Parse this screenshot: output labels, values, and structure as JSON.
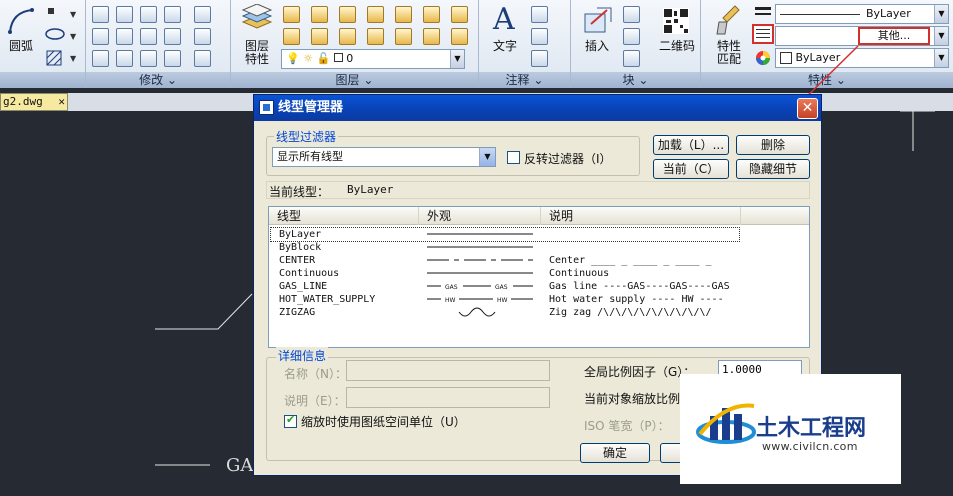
{
  "ribbon": {
    "draw": {
      "arc_label": "圆弧"
    },
    "modify": {
      "title": "修改 ⌄"
    },
    "layers": {
      "props_label_1": "图层",
      "props_label_2": "特性",
      "title": "图层",
      "layer_value": "0"
    },
    "annotation": {
      "text_label": "文字",
      "title": "注释"
    },
    "block": {
      "insert_label": "插入",
      "title": "块"
    },
    "qrcode": {
      "label": "二维码"
    },
    "properties": {
      "match_label_1": "特性",
      "match_label_2": "匹配",
      "lineweight_value": "ByLayer",
      "linetype_value": "其他...",
      "color_value": "ByLayer",
      "title": "特性"
    }
  },
  "doc_tab": {
    "label": "g2.dwg",
    "close": "✕"
  },
  "drawing": {
    "gas_label": "GAS"
  },
  "dialog": {
    "title": "线型管理器",
    "close": "✕",
    "filter_group": "线型过滤器",
    "filter_value": "显示所有线型",
    "invert_filter": "反转过滤器（I）",
    "buttons": {
      "load": "加载（L）...",
      "delete": "删除",
      "current": "当前（C）",
      "hide_details": "隐藏细节（D）"
    },
    "current_linetype_label": "当前线型：",
    "current_linetype_value": "ByLayer",
    "columns": [
      "线型",
      "外观",
      "说明"
    ],
    "rows": [
      {
        "name": "ByLayer",
        "desc": ""
      },
      {
        "name": "ByBlock",
        "desc": ""
      },
      {
        "name": "CENTER",
        "desc": "Center ____ _ ____ _ ____ _"
      },
      {
        "name": "Continuous",
        "desc": "Continuous"
      },
      {
        "name": "GAS_LINE",
        "desc": "Gas line ----GAS----GAS----GAS"
      },
      {
        "name": "HOT_WATER_SUPPLY",
        "desc": "Hot water supply ---- HW ----"
      },
      {
        "name": "ZIGZAG",
        "desc": "Zig zag /\\/\\/\\/\\/\\/\\/\\/\\/\\/"
      }
    ],
    "details_group": "详细信息",
    "name_label": "名称（N）：",
    "desc_label": "说明（E）：",
    "paper_units": "缩放时使用图纸空间单位（U）",
    "global_scale_label": "全局比例因子（G）：",
    "global_scale_value": "1.0000",
    "current_scale_label": "当前对象缩放比例",
    "iso_label": "ISO 笔宽（P）：",
    "ok": "确定"
  },
  "watermark": {
    "brand": "土木工程网",
    "url": "www.civilcn.com"
  },
  "colors": {
    "accent": "#d4302b",
    "title_bar": "#0a54d6",
    "canvas": "#252a33"
  }
}
